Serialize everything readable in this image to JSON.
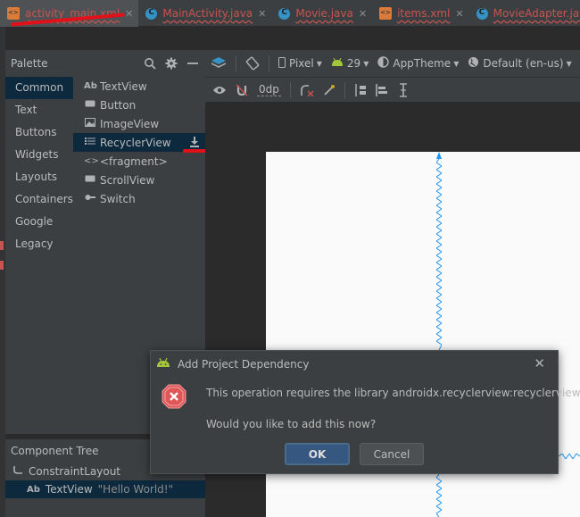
{
  "tabs": [
    {
      "label": "activity_main.xml",
      "icon": "xml-file-icon",
      "active": true
    },
    {
      "label": "MainActivity.java",
      "icon": "class-icon"
    },
    {
      "label": "Movie.java",
      "icon": "class-icon"
    },
    {
      "label": "items.xml",
      "icon": "xml-file-icon"
    },
    {
      "label": "MovieAdapter.java",
      "icon": "class-icon"
    }
  ],
  "palette": {
    "title": "Palette",
    "categories": [
      "Common",
      "Text",
      "Buttons",
      "Widgets",
      "Layouts",
      "Containers",
      "Google",
      "Legacy"
    ],
    "selected_category": "Common",
    "items": [
      {
        "label": "TextView",
        "icon": "Ab"
      },
      {
        "label": "Button",
        "icon": "button-icon"
      },
      {
        "label": "ImageView",
        "icon": "image-icon"
      },
      {
        "label": "RecyclerView",
        "icon": "list-icon",
        "selected": true
      },
      {
        "label": "<fragment>",
        "icon": "code-brackets-icon"
      },
      {
        "label": "ScrollView",
        "icon": "scroll-icon"
      },
      {
        "label": "Switch",
        "icon": "switch-icon"
      }
    ]
  },
  "toolbar": {
    "device": "Pixel",
    "api": "29",
    "theme": "AppTheme",
    "locale": "Default (en-us)",
    "margin": "0dp"
  },
  "component_tree": {
    "title": "Component Tree",
    "root": "ConstraintLayout",
    "child_label": "TextView",
    "child_icon": "Ab",
    "child_hint": "\"Hello World!\""
  },
  "dialog": {
    "title": "Add Project Dependency",
    "message": "This operation requires the library androidx.recyclerview:recyclerview:+.",
    "question": "Would you like to add this now?",
    "ok_label": "OK",
    "cancel_label": "Cancel"
  },
  "colors": {
    "error_tab_text": "#c75450",
    "selection": "#0d293e",
    "android_green": "#a4c639",
    "annotation_red": "#e1111a",
    "constraint_blue": "#2196f3"
  }
}
